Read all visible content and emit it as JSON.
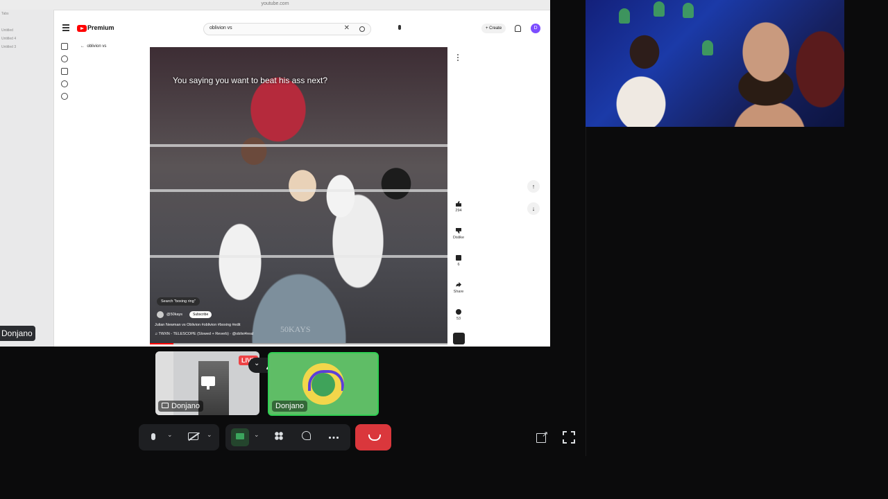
{
  "browser": {
    "url": "youtube.com",
    "sidebar_items": [
      "Tabs",
      "",
      "Untitled",
      "Untitled 4",
      "Untitled 3"
    ]
  },
  "youtube": {
    "logo_text": "Premium",
    "search_value": "oblivion vs",
    "clear_glyph": "✕",
    "create_label": "Create",
    "account_initial": "D",
    "back_search_label": "oblivion vs",
    "video": {
      "subtitle": "You saying you want to beat his ass next?",
      "search_chip": "Search \"boxing ring\"",
      "channel": "@50kays",
      "subscribe_label": "Subscribe",
      "title": "Julian Newman vs Oblivion #oblivion #boxing #edit",
      "music": "♫ TWXN - TELESCOPE (Slowed + Reverb) · @oblivi4real",
      "watermark": "50KAYS",
      "progress": 0.08
    },
    "actions": {
      "like_count": "294",
      "dislike_label": "Dislike",
      "comments_count": "6",
      "share_label": "Share",
      "remix_count": "53"
    },
    "nav_up": "↑",
    "nav_down": "↓"
  },
  "call": {
    "stream_owner_tag": "Donjano",
    "live_badge": "LIVE",
    "tile_menu_chevron": "⌄",
    "stream_tile_label": "Donjano",
    "user_tile_label": "Donjano",
    "chevron": "⌄",
    "popout_arrow": "↗",
    "accent_speaking": "#2fd052",
    "disconnect_color": "#da373c"
  }
}
